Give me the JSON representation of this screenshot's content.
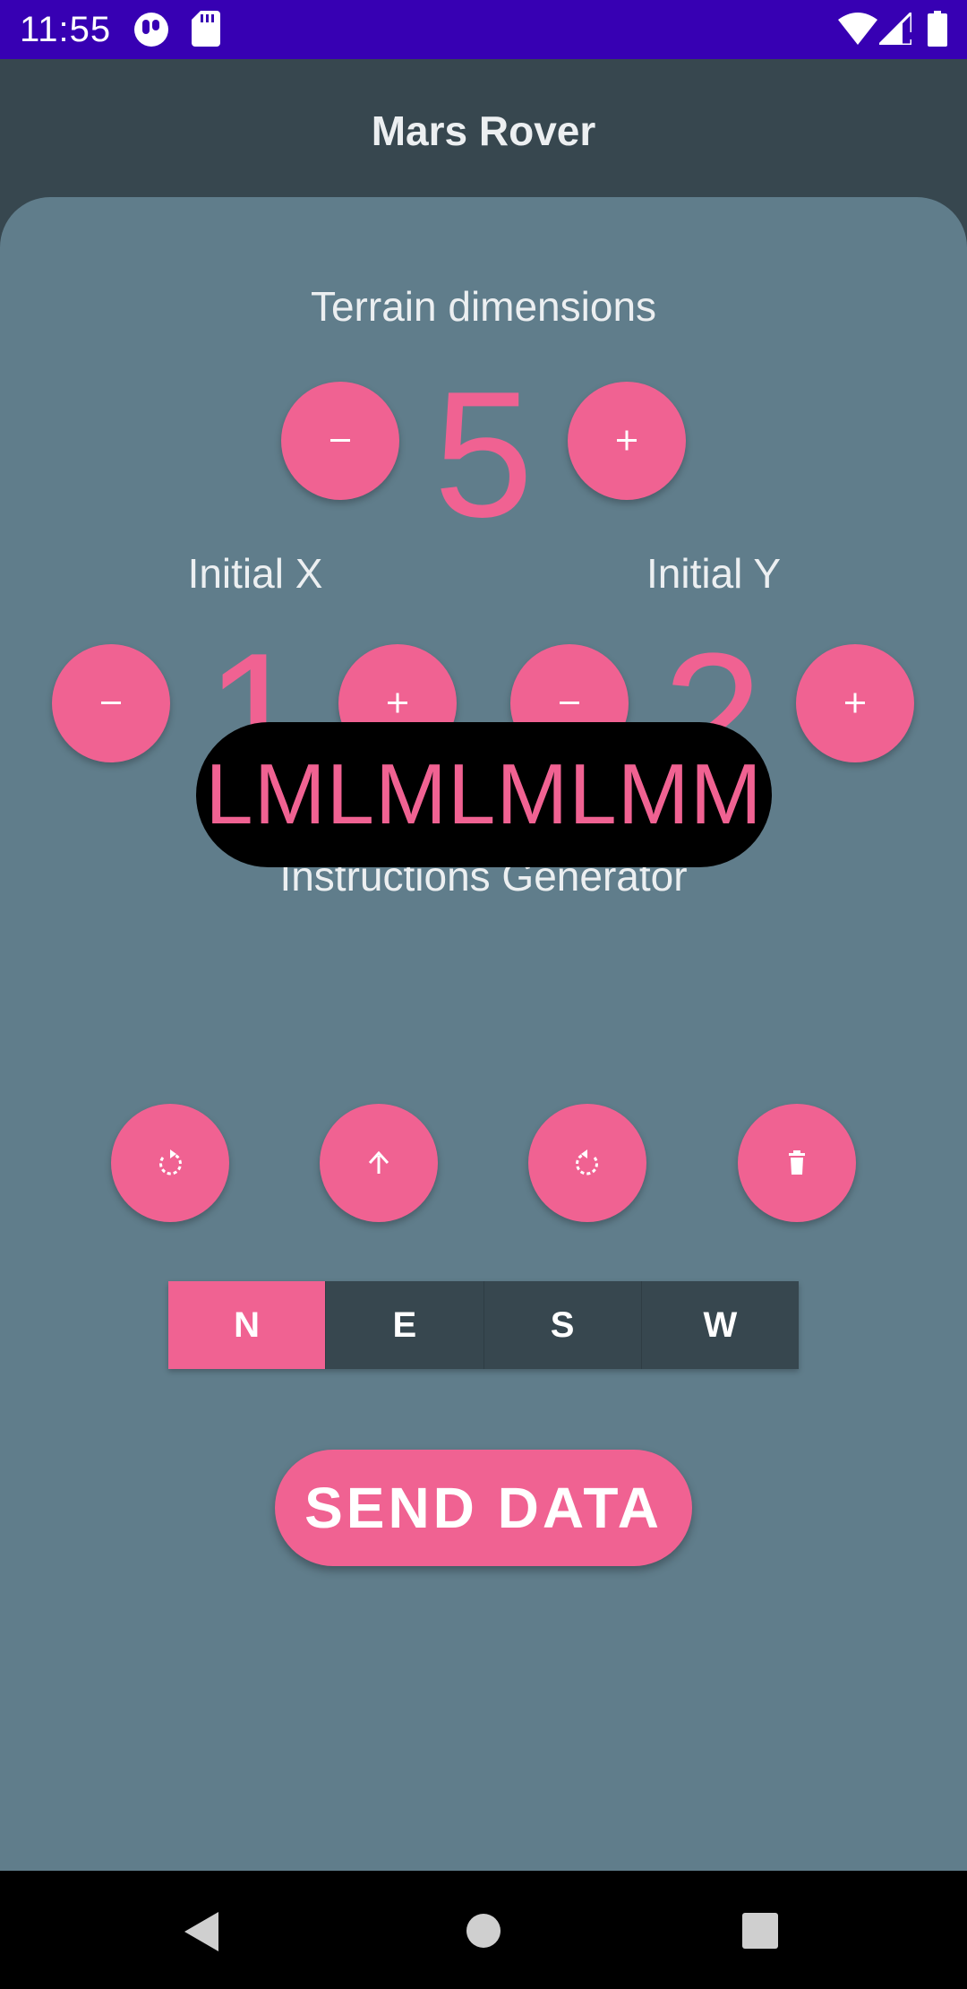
{
  "status_bar": {
    "time": "11:55",
    "icons": [
      "data-saver-icon",
      "sd-card-icon",
      "wifi-icon",
      "signal-icon",
      "battery-icon"
    ]
  },
  "app_bar": {
    "title": "Mars Rover"
  },
  "terrain": {
    "label": "Terrain dimensions",
    "value": "5"
  },
  "initial_x": {
    "label": "Initial X",
    "value": "1"
  },
  "initial_y": {
    "label": "Initial Y",
    "value": "2"
  },
  "instructions": {
    "label": "Instructions Generator",
    "value": "LMLMLMLMM",
    "buttons": [
      "rotate-left-icon",
      "arrow-up-icon",
      "rotate-right-icon",
      "trash-icon"
    ]
  },
  "direction": {
    "options": [
      "N",
      "E",
      "S",
      "W"
    ],
    "selected": "N"
  },
  "send_button": {
    "label": "SEND DATA"
  },
  "colors": {
    "accent": "#f06292",
    "status_bar": "#3700b3",
    "app_bar": "#37474f",
    "content_bg": "#607d8b",
    "instruction_pill": "#000000"
  }
}
